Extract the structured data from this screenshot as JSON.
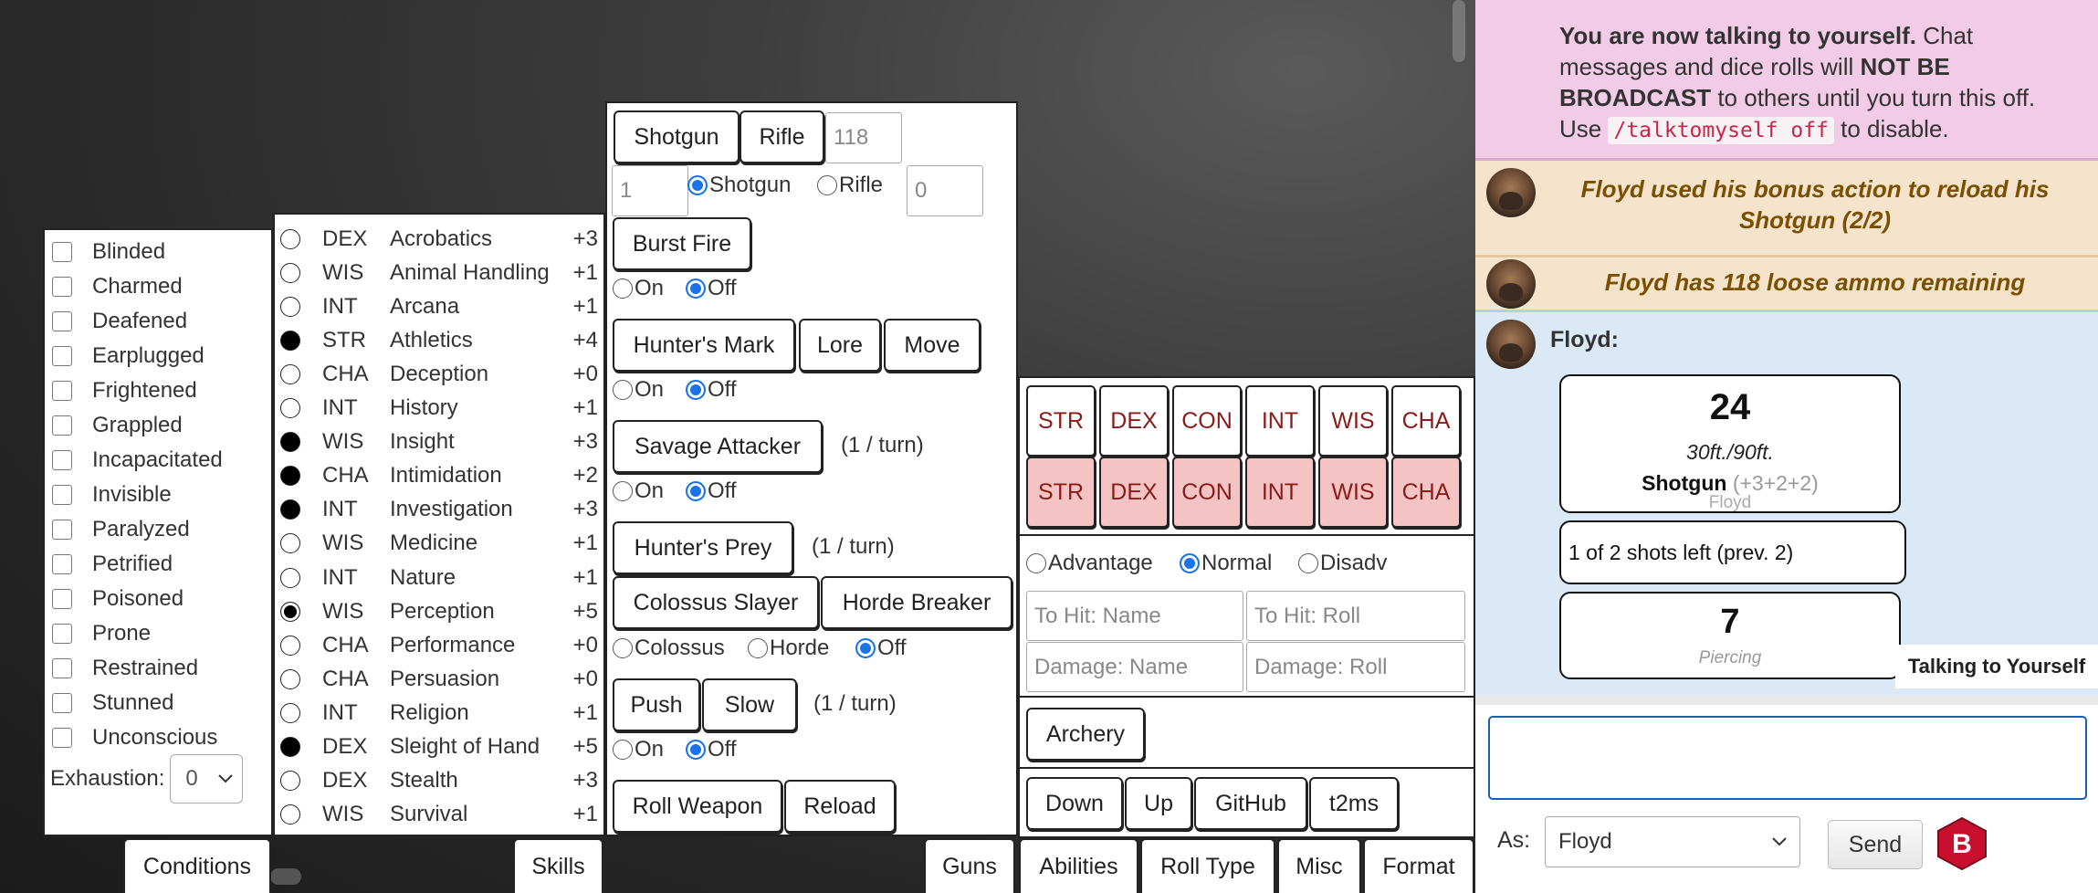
{
  "conditions": {
    "items": [
      "Blinded",
      "Charmed",
      "Deafened",
      "Earplugged",
      "Frightened",
      "Grappled",
      "Incapacitated",
      "Invisible",
      "Paralyzed",
      "Petrified",
      "Poisoned",
      "Prone",
      "Restrained",
      "Stunned",
      "Unconscious"
    ],
    "exhaustion_label": "Exhaustion:",
    "exhaustion_value": "0"
  },
  "skills": [
    {
      "ab": "DEX",
      "name": "Acrobatics",
      "mod": "+3",
      "prof": "none"
    },
    {
      "ab": "WIS",
      "name": "Animal Handling",
      "mod": "+1",
      "prof": "none"
    },
    {
      "ab": "INT",
      "name": "Arcana",
      "mod": "+1",
      "prof": "none"
    },
    {
      "ab": "STR",
      "name": "Athletics",
      "mod": "+4",
      "prof": "proficient"
    },
    {
      "ab": "CHA",
      "name": "Deception",
      "mod": "+0",
      "prof": "none"
    },
    {
      "ab": "INT",
      "name": "History",
      "mod": "+1",
      "prof": "none"
    },
    {
      "ab": "WIS",
      "name": "Insight",
      "mod": "+3",
      "prof": "proficient"
    },
    {
      "ab": "CHA",
      "name": "Intimidation",
      "mod": "+2",
      "prof": "proficient"
    },
    {
      "ab": "INT",
      "name": "Investigation",
      "mod": "+3",
      "prof": "proficient"
    },
    {
      "ab": "WIS",
      "name": "Medicine",
      "mod": "+1",
      "prof": "none"
    },
    {
      "ab": "INT",
      "name": "Nature",
      "mod": "+1",
      "prof": "none"
    },
    {
      "ab": "WIS",
      "name": "Perception",
      "mod": "+5",
      "prof": "expertise"
    },
    {
      "ab": "CHA",
      "name": "Performance",
      "mod": "+0",
      "prof": "none"
    },
    {
      "ab": "CHA",
      "name": "Persuasion",
      "mod": "+0",
      "prof": "none"
    },
    {
      "ab": "INT",
      "name": "Religion",
      "mod": "+1",
      "prof": "none"
    },
    {
      "ab": "DEX",
      "name": "Sleight of Hand",
      "mod": "+5",
      "prof": "proficient"
    },
    {
      "ab": "DEX",
      "name": "Stealth",
      "mod": "+3",
      "prof": "none"
    },
    {
      "ab": "WIS",
      "name": "Survival",
      "mod": "+1",
      "prof": "none"
    }
  ],
  "guns": {
    "shotgun": "Shotgun",
    "rifle": "Rifle",
    "ammo_value": "118",
    "count_value": "1",
    "radio_shotgun": "Shotgun",
    "radio_rifle": "Rifle",
    "extra_value": "0",
    "burst_fire": "Burst Fire",
    "on": "On",
    "off": "Off",
    "hunters_mark": "Hunter's Mark",
    "lore": "Lore",
    "move": "Move",
    "savage_attacker": "Savage Attacker",
    "per_turn": "(1 / turn)",
    "hunters_prey": "Hunter's Prey",
    "colossus_slayer": "Colossus Slayer",
    "horde_breaker": "Horde Breaker",
    "colossus": "Colossus",
    "horde": "Horde",
    "push": "Push",
    "slow": "Slow",
    "roll_weapon": "Roll Weapon",
    "reload": "Reload"
  },
  "abilities": {
    "checks": [
      "STR",
      "DEX",
      "CON",
      "INT",
      "WIS",
      "CHA"
    ],
    "saves": [
      "STR",
      "DEX",
      "CON",
      "INT",
      "WIS",
      "CHA"
    ]
  },
  "roll_type": {
    "advantage": "Advantage",
    "normal": "Normal",
    "disadv": "Disadv",
    "selected": "Normal",
    "tohit_name_ph": "To Hit: Name",
    "tohit_roll_ph": "To Hit: Roll",
    "damage_name_ph": "Damage: Name",
    "damage_roll_ph": "Damage: Roll"
  },
  "misc": {
    "archery": "Archery"
  },
  "format": {
    "down": "Down",
    "up": "Up",
    "github": "GitHub",
    "t2ms": "t2ms"
  },
  "tabs": {
    "conditions": "Conditions",
    "skills": "Skills",
    "guns": "Guns",
    "abilities": "Abilities",
    "roll_type": "Roll Type",
    "misc": "Misc",
    "format": "Format"
  },
  "chat": {
    "notice_bold1": "You are now talking to yourself.",
    "notice_text1": " Chat messages and dice rolls will ",
    "notice_bold2": "NOT BE BROADCAST",
    "notice_text2": " to others until you turn this off. Use ",
    "notice_code": "/talktomyself off",
    "notice_text3": " to disable.",
    "emote1": "Floyd used his bonus action to reload his Shotgun (2/2)",
    "emote2": "Floyd has 118 loose ammo remaining",
    "speaker": "Floyd:",
    "roll_total": "24",
    "range": "30ft./90ft.",
    "weapon": "Shotgun",
    "weapon_mods": "(+3+2+2)",
    "char_name": "Floyd",
    "shots_left": "1 of 2 shots left (prev. 2)",
    "damage_total": "7",
    "damage_type": "Piercing",
    "talking_badge": "Talking to Yourself",
    "as_label": "As:",
    "as_value": "Floyd",
    "send": "Send",
    "logo_letter": "B",
    "colors": {
      "notice_bg": "#f2cce6",
      "emote_bg": "#f5e3cc",
      "roll_bg": "#dbe8f6",
      "emote_text": "#7a5000",
      "input_border": "#1a5fb4"
    }
  }
}
